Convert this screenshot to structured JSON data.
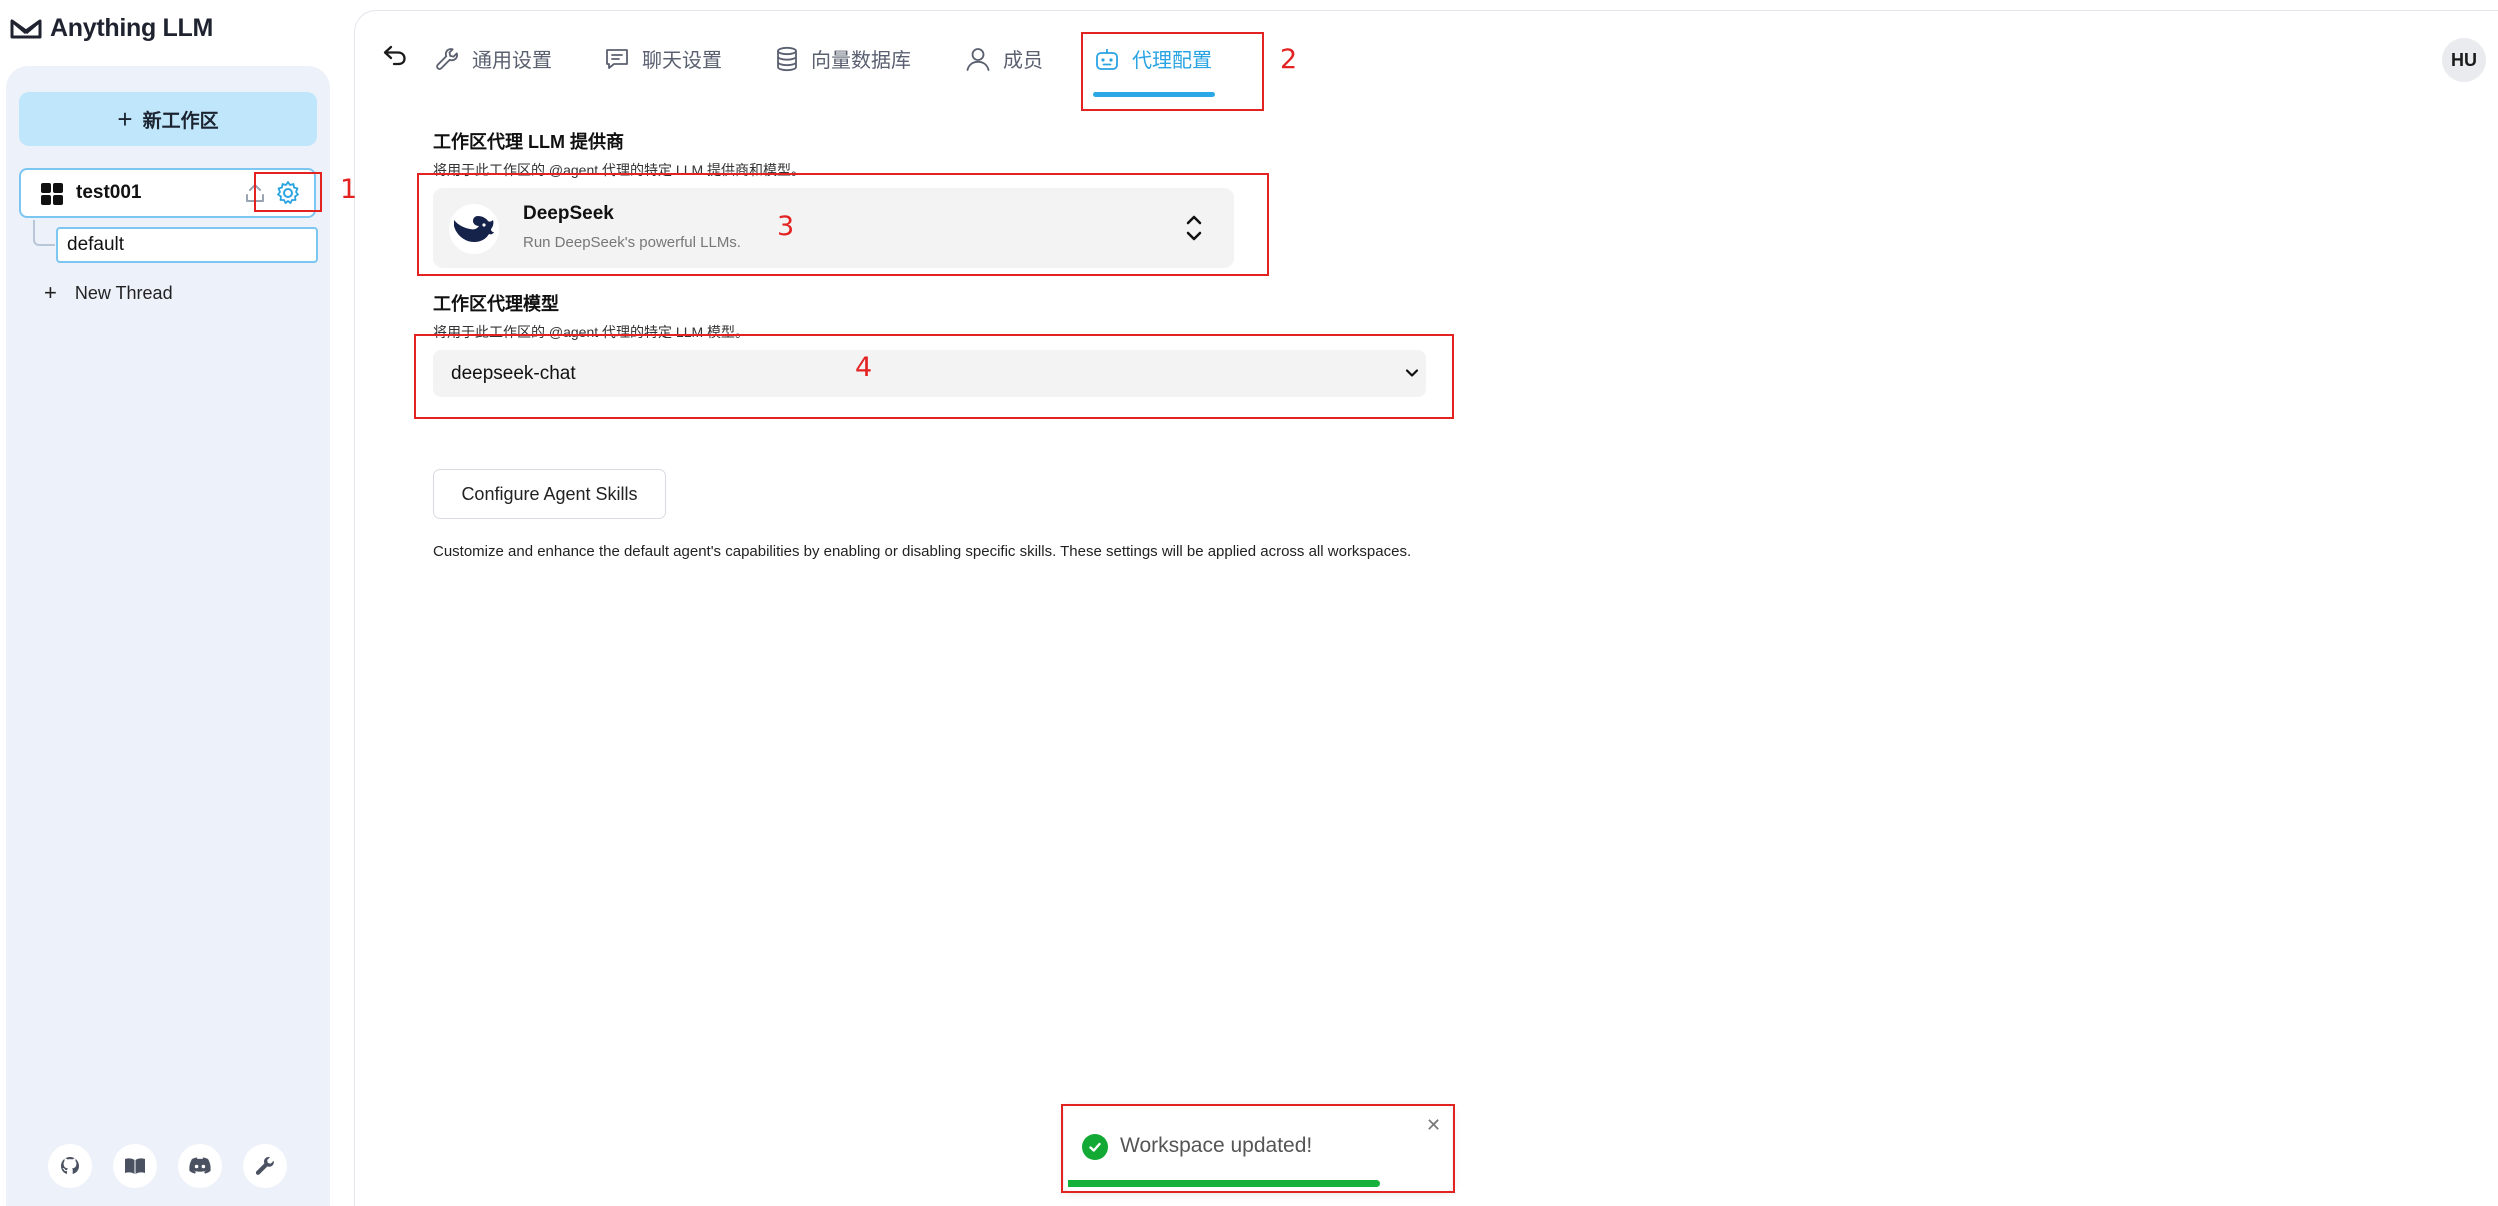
{
  "app": {
    "title": "Anything LLM"
  },
  "sidebar": {
    "new_workspace_label": "新工作区",
    "workspace_name": "test001",
    "thread_default": "default",
    "new_thread_label": "New Thread",
    "footer_icons": [
      "github-icon",
      "book-icon",
      "discord-icon",
      "wrench-icon"
    ]
  },
  "tabs": [
    {
      "label": "通用设置",
      "icon": "wrench-icon",
      "active": false
    },
    {
      "label": "聊天设置",
      "icon": "chat-icon",
      "active": false
    },
    {
      "label": "向量数据库",
      "icon": "database-icon",
      "active": false
    },
    {
      "label": "成员",
      "icon": "user-icon",
      "active": false
    },
    {
      "label": "代理配置",
      "icon": "robot-icon",
      "active": true
    }
  ],
  "user": {
    "avatar_initials": "HU"
  },
  "agent_provider": {
    "title": "工作区代理 LLM 提供商",
    "description": "将用于此工作区的 @agent 代理的特定 LLM 提供商和模型。",
    "name": "DeepSeek",
    "subtitle": "Run DeepSeek's powerful LLMs."
  },
  "agent_model": {
    "title": "工作区代理模型",
    "description": "将用于此工作区的 @agent 代理的特定 LLM 模型。",
    "value": "deepseek-chat"
  },
  "skills": {
    "button_label": "Configure Agent Skills",
    "description": "Customize and enhance the default agent's capabilities by enabling or disabling specific skills. These settings will be applied across all workspaces."
  },
  "annotations": [
    "1",
    "2",
    "3",
    "4"
  ],
  "toast": {
    "message": "Workspace updated!",
    "progress": 0.82
  },
  "colors": {
    "accent": "#29a3e2",
    "annotation": "#e32222",
    "success": "#12a935",
    "new_workspace_bg": "#bfe6fb"
  }
}
